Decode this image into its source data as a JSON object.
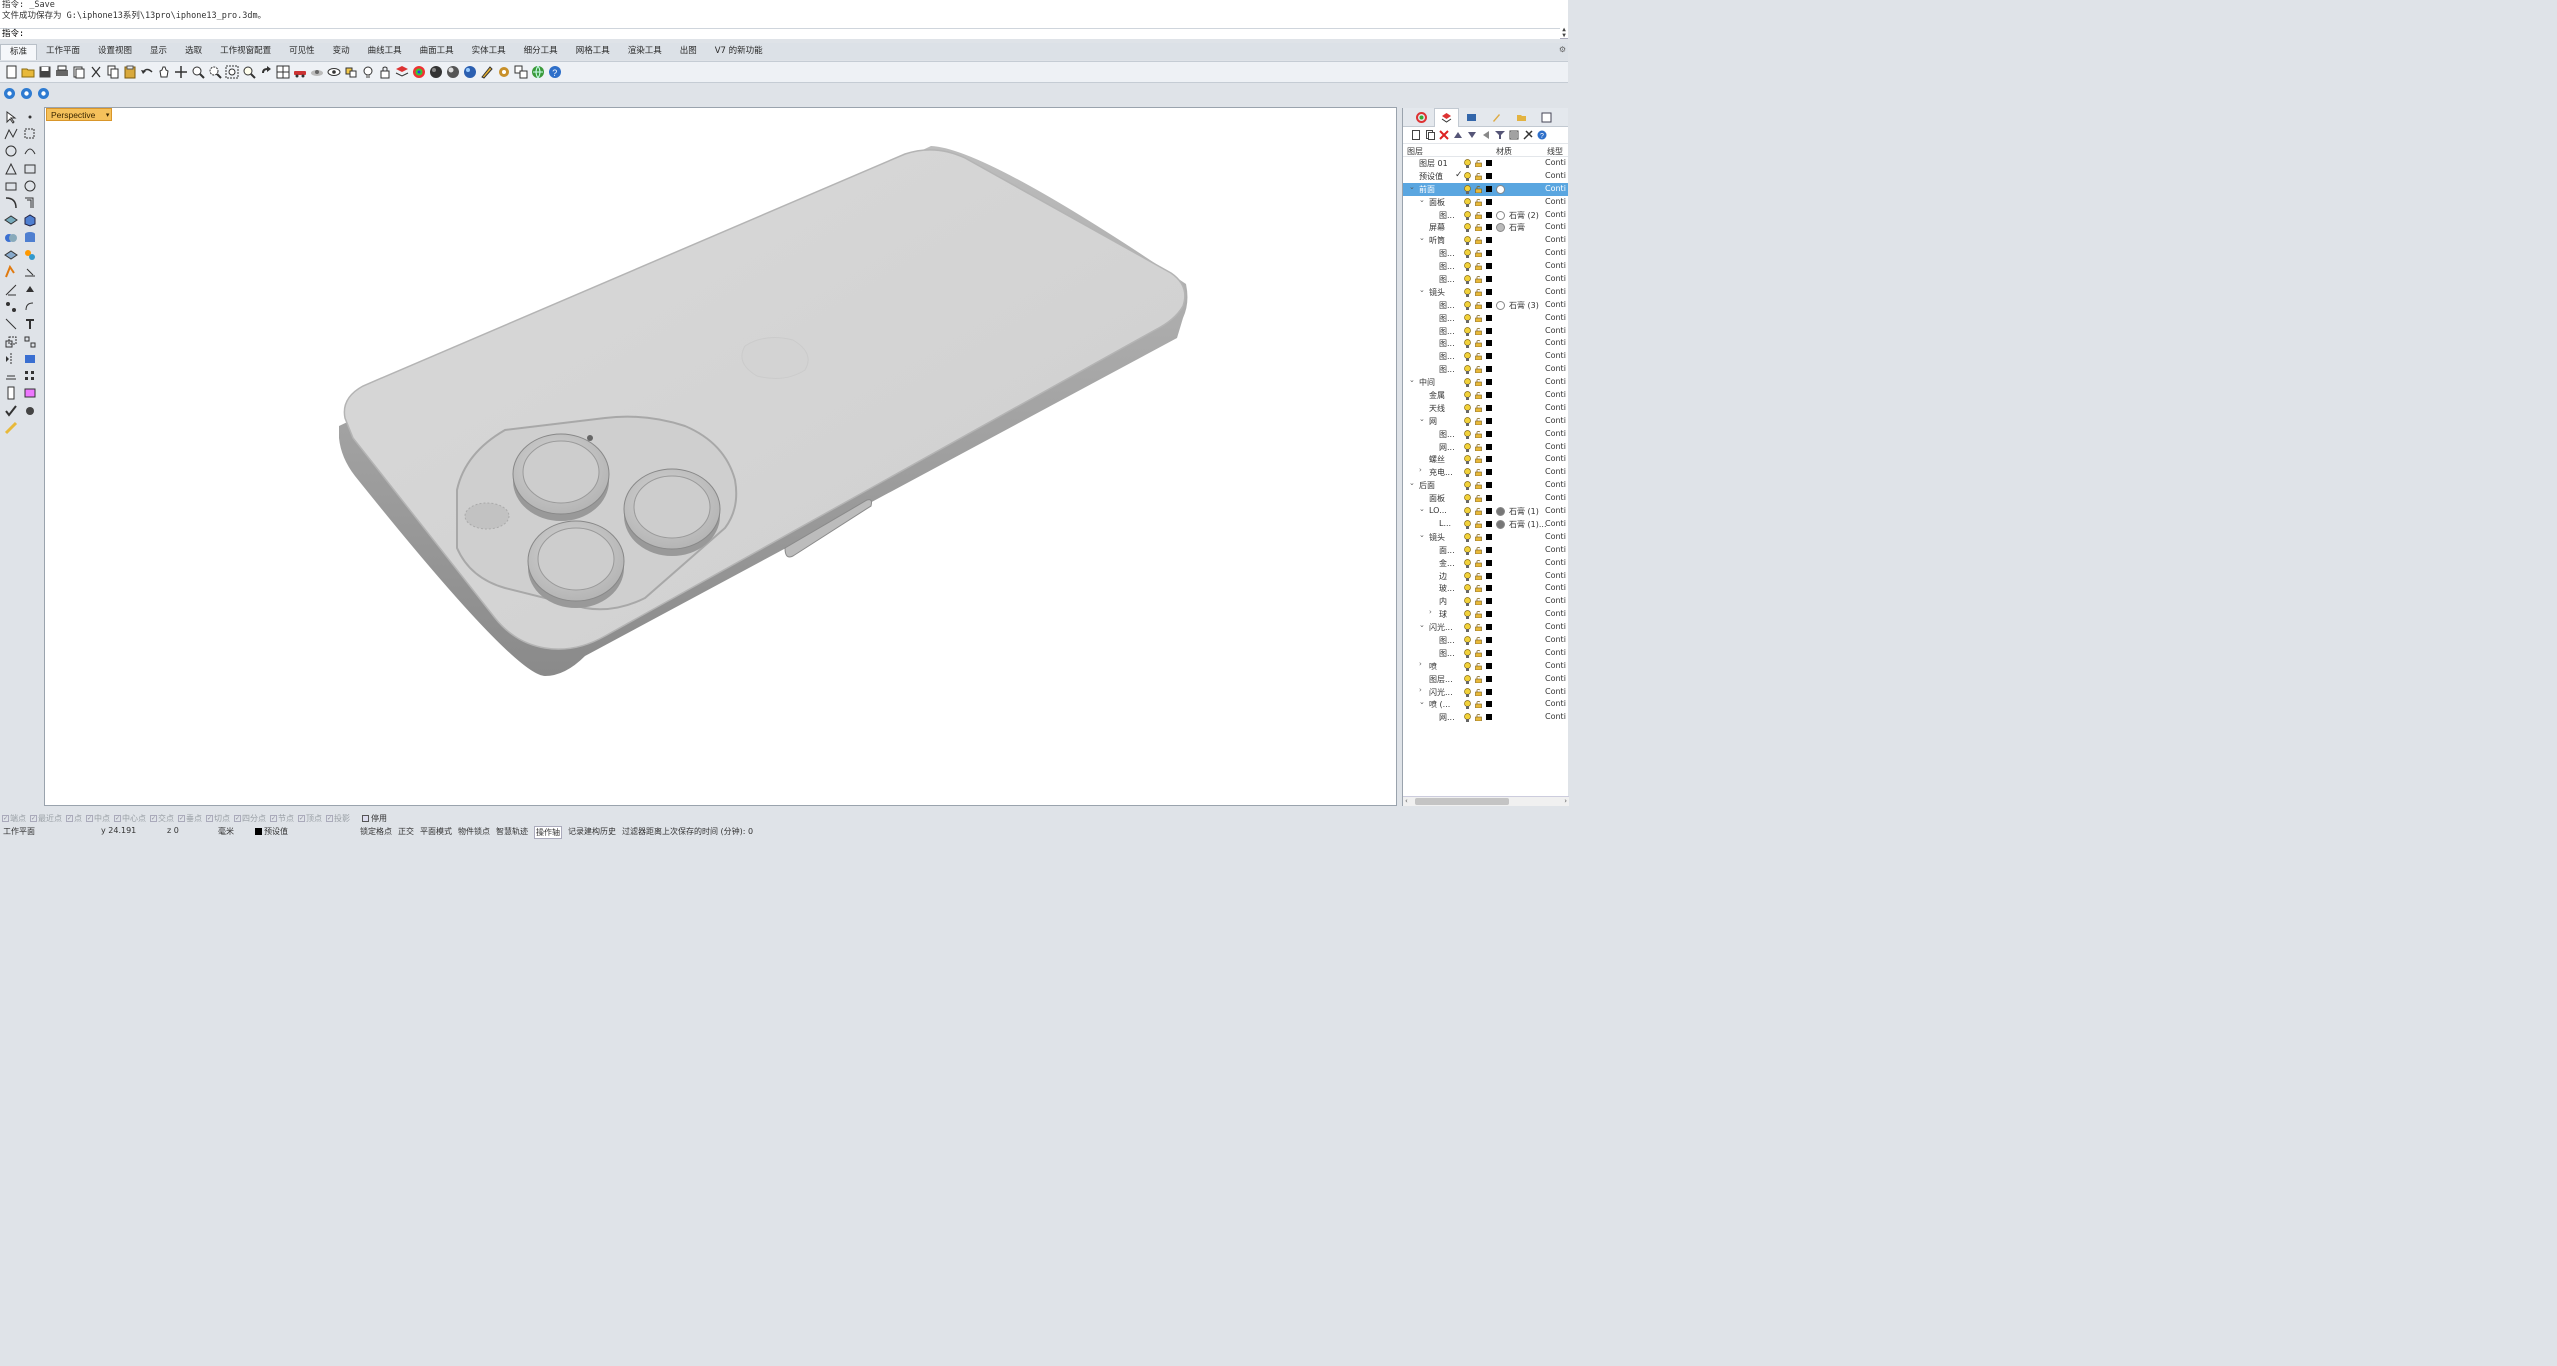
{
  "command": {
    "history": [
      "指令: _Save",
      "文件成功保存为 G:\\iphone13系列\\13pro\\iphone13_pro.3dm。"
    ],
    "prompt": "指令:"
  },
  "tabs": [
    "标准",
    "工作平面",
    "设置视图",
    "显示",
    "选取",
    "工作视窗配置",
    "可见性",
    "变动",
    "曲线工具",
    "曲面工具",
    "实体工具",
    "细分工具",
    "网格工具",
    "渲染工具",
    "出图",
    "V7 的新功能"
  ],
  "active_tab": "标准",
  "viewport": {
    "title": "Perspective"
  },
  "layers": {
    "header": {
      "name": "图层",
      "material": "材质",
      "linetype": "线型"
    },
    "rows": [
      {
        "name": "图层 01",
        "indent": 0,
        "exp": "",
        "linetype": "Conti"
      },
      {
        "name": "预设值",
        "indent": 0,
        "exp": "",
        "current": "✓",
        "linetype": "Conti"
      },
      {
        "name": "前面",
        "indent": 0,
        "exp": "⌄",
        "selected": true,
        "mat": "white",
        "linetype": "Conti"
      },
      {
        "name": "面板",
        "indent": 1,
        "exp": "⌄",
        "linetype": "Conti"
      },
      {
        "name": "图...",
        "indent": 2,
        "exp": "",
        "mat": "white",
        "material": "石膏 (2)",
        "linetype": "Conti"
      },
      {
        "name": "屏幕",
        "indent": 1,
        "exp": "",
        "mat": "gray",
        "material": "石膏",
        "linetype": "Conti"
      },
      {
        "name": "听筒",
        "indent": 1,
        "exp": "⌄",
        "linetype": "Conti"
      },
      {
        "name": "图...",
        "indent": 2,
        "exp": "",
        "linetype": "Conti"
      },
      {
        "name": "图...",
        "indent": 2,
        "exp": "",
        "linetype": "Conti"
      },
      {
        "name": "图...",
        "indent": 2,
        "exp": "",
        "linetype": "Conti"
      },
      {
        "name": "镜头",
        "indent": 1,
        "exp": "⌄",
        "linetype": "Conti"
      },
      {
        "name": "图...",
        "indent": 2,
        "exp": "",
        "mat": "white",
        "material": "石膏 (3)",
        "linetype": "Conti"
      },
      {
        "name": "图...",
        "indent": 2,
        "exp": "",
        "linetype": "Conti"
      },
      {
        "name": "图...",
        "indent": 2,
        "exp": "",
        "linetype": "Conti"
      },
      {
        "name": "图...",
        "indent": 2,
        "exp": "",
        "linetype": "Conti"
      },
      {
        "name": "图...",
        "indent": 2,
        "exp": "",
        "linetype": "Conti"
      },
      {
        "name": "图...",
        "indent": 2,
        "exp": "",
        "linetype": "Conti"
      },
      {
        "name": "中间",
        "indent": 0,
        "exp": "⌄",
        "linetype": "Conti"
      },
      {
        "name": "金属",
        "indent": 1,
        "exp": "",
        "linetype": "Conti"
      },
      {
        "name": "天线",
        "indent": 1,
        "exp": "",
        "linetype": "Conti"
      },
      {
        "name": "网",
        "indent": 1,
        "exp": "⌄",
        "linetype": "Conti"
      },
      {
        "name": "图...",
        "indent": 2,
        "exp": "",
        "linetype": "Conti"
      },
      {
        "name": "网...",
        "indent": 2,
        "exp": "",
        "linetype": "Conti"
      },
      {
        "name": "螺丝",
        "indent": 1,
        "exp": "",
        "linetype": "Conti"
      },
      {
        "name": "充电...",
        "indent": 1,
        "exp": "›",
        "linetype": "Conti"
      },
      {
        "name": "后面",
        "indent": 0,
        "exp": "⌄",
        "linetype": "Conti"
      },
      {
        "name": "面板",
        "indent": 1,
        "exp": "",
        "linetype": "Conti"
      },
      {
        "name": "LO...",
        "indent": 1,
        "exp": "⌄",
        "mat": "dark",
        "material": "石膏 (1)",
        "linetype": "Conti"
      },
      {
        "name": "L...",
        "indent": 2,
        "exp": "",
        "mat": "dark",
        "material": "石膏 (1)...",
        "linetype": "Conti"
      },
      {
        "name": "镜头",
        "indent": 1,
        "exp": "⌄",
        "linetype": "Conti"
      },
      {
        "name": "面...",
        "indent": 2,
        "exp": "",
        "linetype": "Conti"
      },
      {
        "name": "金...",
        "indent": 2,
        "exp": "",
        "linetype": "Conti"
      },
      {
        "name": "边",
        "indent": 2,
        "exp": "",
        "linetype": "Conti"
      },
      {
        "name": "玻...",
        "indent": 2,
        "exp": "",
        "linetype": "Conti"
      },
      {
        "name": "内",
        "indent": 2,
        "exp": "",
        "linetype": "Conti"
      },
      {
        "name": "球",
        "indent": 2,
        "exp": "›",
        "linetype": "Conti"
      },
      {
        "name": "闪光...",
        "indent": 1,
        "exp": "⌄",
        "linetype": "Conti"
      },
      {
        "name": "图...",
        "indent": 2,
        "exp": "",
        "linetype": "Conti"
      },
      {
        "name": "图...",
        "indent": 2,
        "exp": "",
        "linetype": "Conti"
      },
      {
        "name": "喷",
        "indent": 1,
        "exp": "›",
        "linetype": "Conti"
      },
      {
        "name": "图层...",
        "indent": 1,
        "exp": "",
        "linetype": "Conti"
      },
      {
        "name": "闪光...",
        "indent": 1,
        "exp": "›",
        "linetype": "Conti"
      },
      {
        "name": "喷 (...",
        "indent": 1,
        "exp": "⌄",
        "linetype": "Conti"
      },
      {
        "name": "网...",
        "indent": 2,
        "exp": "",
        "linetype": "Conti"
      }
    ]
  },
  "osnaps": [
    "端点",
    "最近点",
    "点",
    "中点",
    "中心点",
    "交点",
    "垂点",
    "切点",
    "四分点",
    "节点",
    "顶点",
    "投影"
  ],
  "osnap_disable": "停用",
  "status": {
    "cplane": "工作平面",
    "y": "y 24.191",
    "z": "z 0",
    "units": "毫米",
    "layer": "预设值",
    "toggles": [
      "锁定格点",
      "正交",
      "平面模式",
      "物件锁点",
      "智慧轨迹",
      "操作轴",
      "记录建构历史",
      "过滤器"
    ],
    "active_toggle": "操作轴",
    "autosave": "距离上次保存的时间 (分钟): 0"
  },
  "colors": {
    "accent": "#5aa6e0",
    "viewport_title": "#f5c15b"
  }
}
